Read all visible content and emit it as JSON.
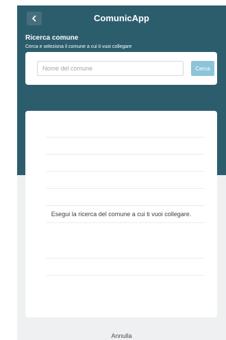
{
  "header": {
    "back_icon": "chevron-left-icon",
    "title": "ComunicApp"
  },
  "section": {
    "title": "Ricerca comune",
    "subtitle": "Cerca e seleziona il comune a cui ti vuoi collegare"
  },
  "search": {
    "placeholder": "Nome del comune",
    "value": "",
    "button_label": "Cerca"
  },
  "results": {
    "empty_message": "Esegui la ricerca del comune a cui ti vuoi collegare."
  },
  "footer": {
    "cancel_label": "Annulla"
  },
  "colors": {
    "header_bg": "#2c5d6d",
    "search_button": "#8cc4d9",
    "page_bg": "#eef0f1"
  }
}
